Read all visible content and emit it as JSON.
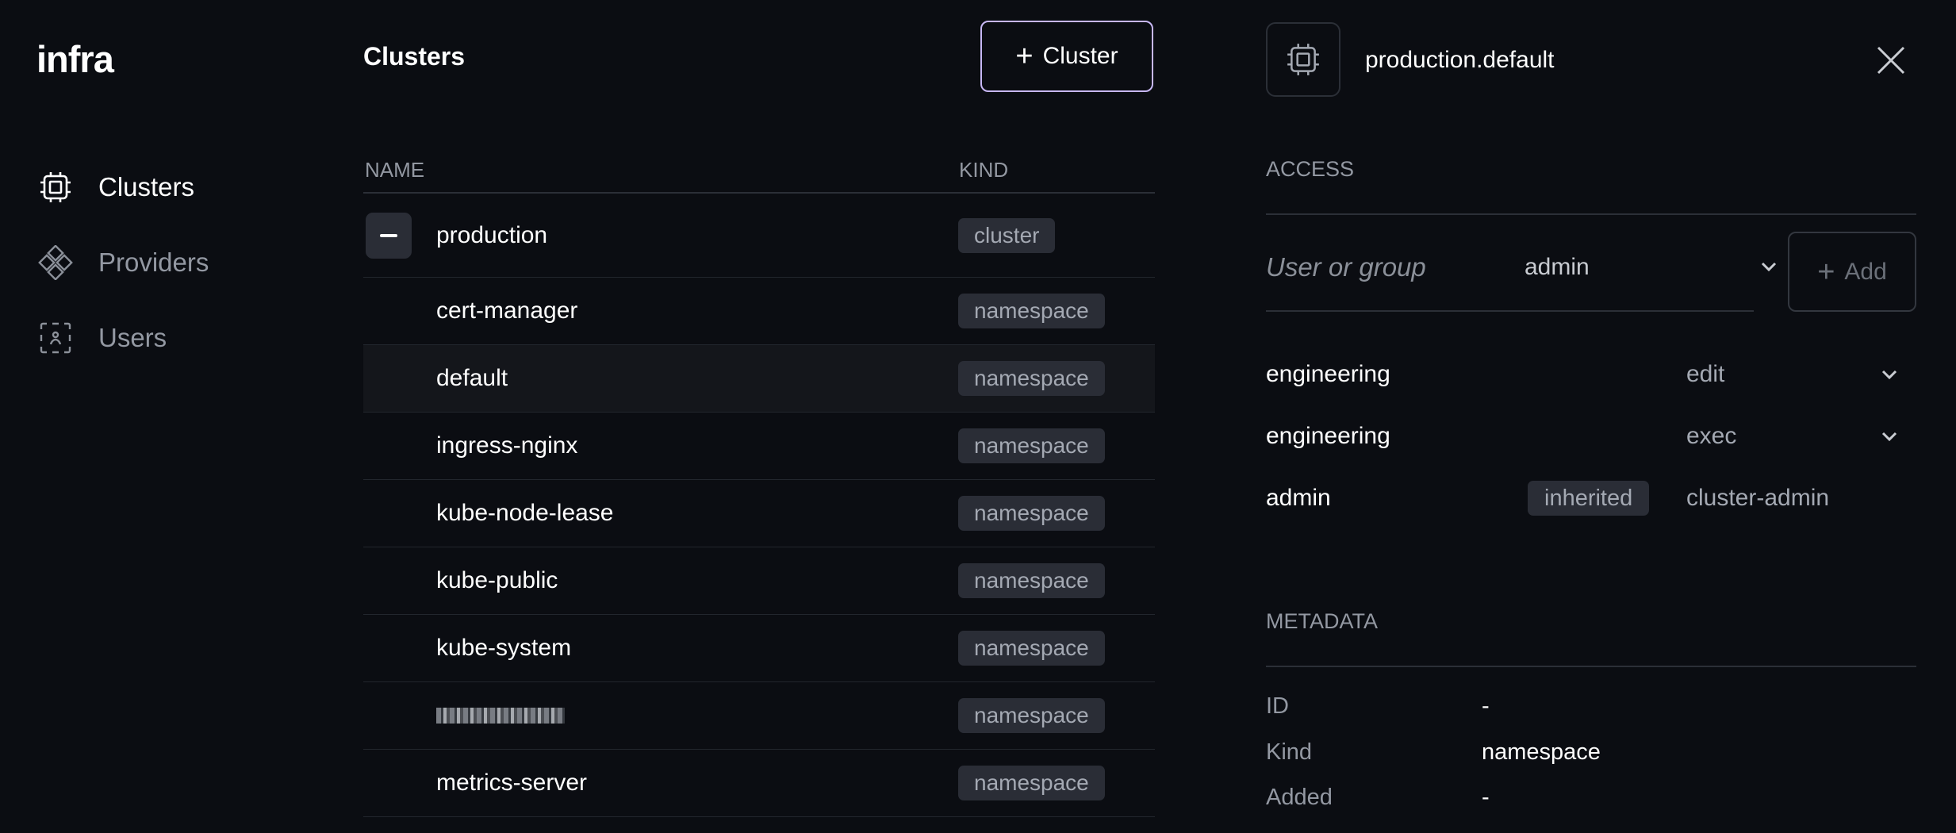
{
  "app": {
    "logo": "infra"
  },
  "sidebar": {
    "items": [
      {
        "label": "Clusters",
        "icon": "chip-icon",
        "active": true
      },
      {
        "label": "Providers",
        "icon": "providers-icon",
        "active": false
      },
      {
        "label": "Users",
        "icon": "users-icon",
        "active": false
      }
    ]
  },
  "clusters": {
    "title": "Clusters",
    "add_button": "Cluster",
    "columns": {
      "name": "NAME",
      "kind": "KIND"
    },
    "rows": [
      {
        "name": "production",
        "kind": "cluster"
      },
      {
        "name": "cert-manager",
        "kind": "namespace"
      },
      {
        "name": "default",
        "kind": "namespace"
      },
      {
        "name": "ingress-nginx",
        "kind": "namespace"
      },
      {
        "name": "kube-node-lease",
        "kind": "namespace"
      },
      {
        "name": "kube-public",
        "kind": "namespace"
      },
      {
        "name": "kube-system",
        "kind": "namespace"
      },
      {
        "name": "",
        "kind": "namespace"
      },
      {
        "name": "metrics-server",
        "kind": "namespace"
      }
    ]
  },
  "details": {
    "title": "production.default",
    "access_label": "ACCESS",
    "user_placeholder": "User or group",
    "role_value": "admin",
    "add_button": "Add",
    "grants": [
      {
        "name": "engineering",
        "role": "edit"
      },
      {
        "name": "engineering",
        "role": "exec"
      },
      {
        "name": "admin",
        "badge": "inherited",
        "role": "cluster-admin"
      }
    ],
    "metadata_label": "METADATA",
    "metadata": [
      {
        "key": "ID",
        "value": "-"
      },
      {
        "key": "Kind",
        "value": "namespace"
      },
      {
        "key": "Added",
        "value": "-"
      }
    ]
  },
  "colors": {
    "background": "#0b0d12",
    "accent_border": "#c7b7f4",
    "badge_bg": "#2a2d36",
    "muted_text": "#9398a2"
  }
}
